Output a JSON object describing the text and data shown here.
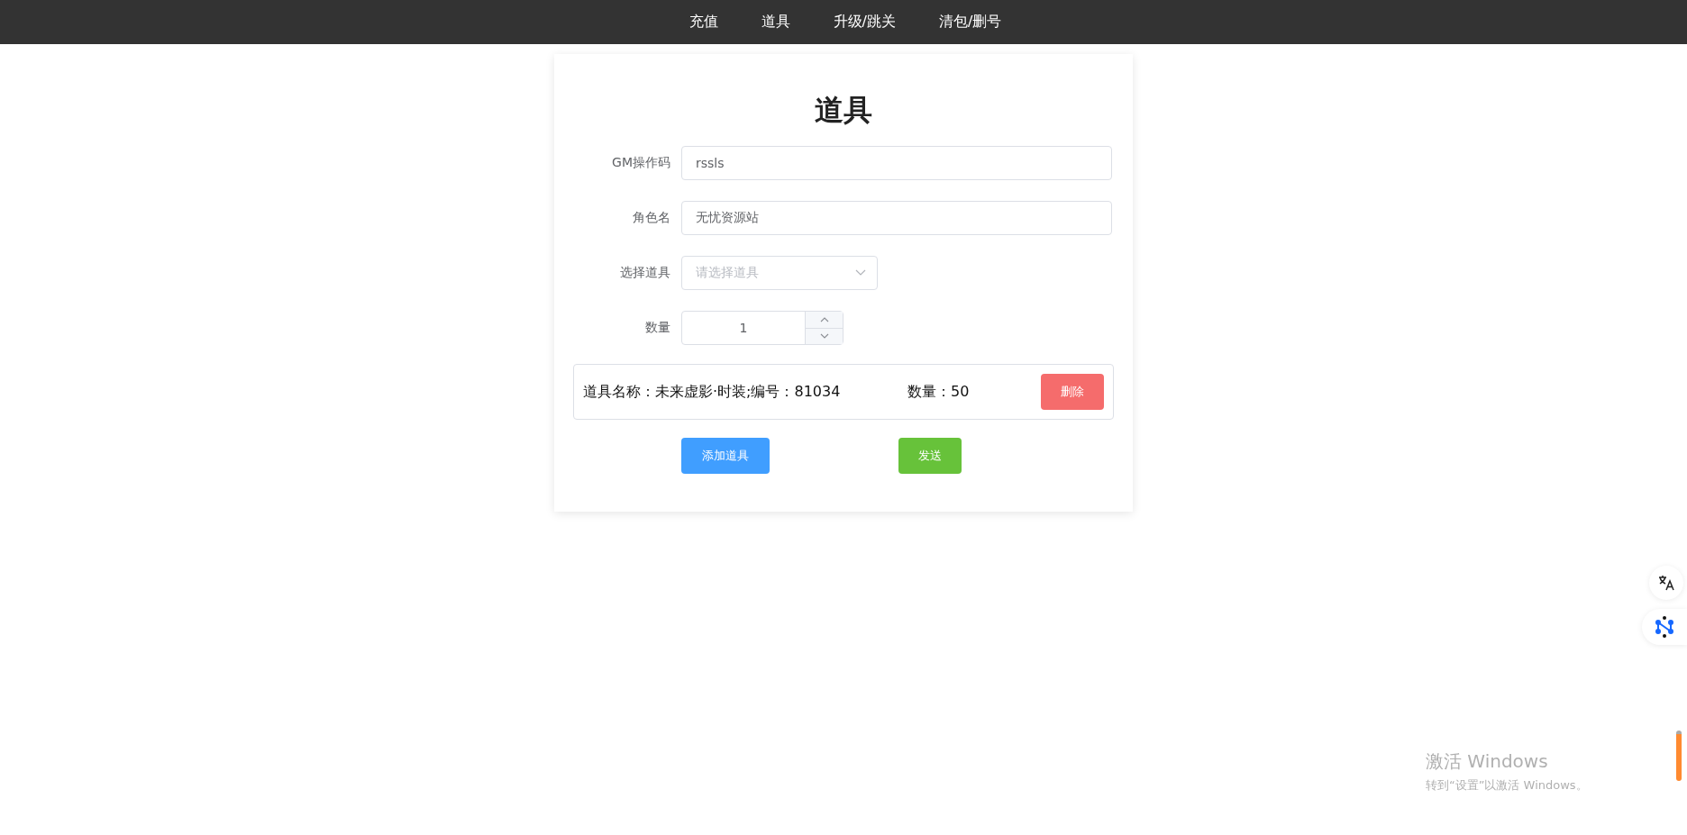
{
  "nav": {
    "items": [
      {
        "label": "充值"
      },
      {
        "label": "道具"
      },
      {
        "label": "升级/跳关"
      },
      {
        "label": "清包/删号"
      }
    ]
  },
  "form": {
    "title": "道具",
    "fields": [
      {
        "kind": "text",
        "label": "GM操作码",
        "value": "rssls"
      },
      {
        "kind": "text",
        "label": "角色名",
        "value": "无忧资源站"
      },
      {
        "kind": "select",
        "label": "选择道具",
        "placeholder": "请选择道具"
      },
      {
        "kind": "number",
        "label": "数量",
        "value": "1"
      }
    ],
    "items": [
      {
        "name": "道具名称：未来虚影·时装;编号：81034",
        "quantity": "数量：50",
        "delete_button": "删除"
      }
    ],
    "buttons": [
      {
        "kind": "primary",
        "label": "添加道具"
      },
      {
        "kind": "success",
        "label": "发送"
      }
    ]
  },
  "os_notice": {
    "title": "激活 Windows",
    "subtitle": "转到“设置”以激活 Windows。"
  }
}
